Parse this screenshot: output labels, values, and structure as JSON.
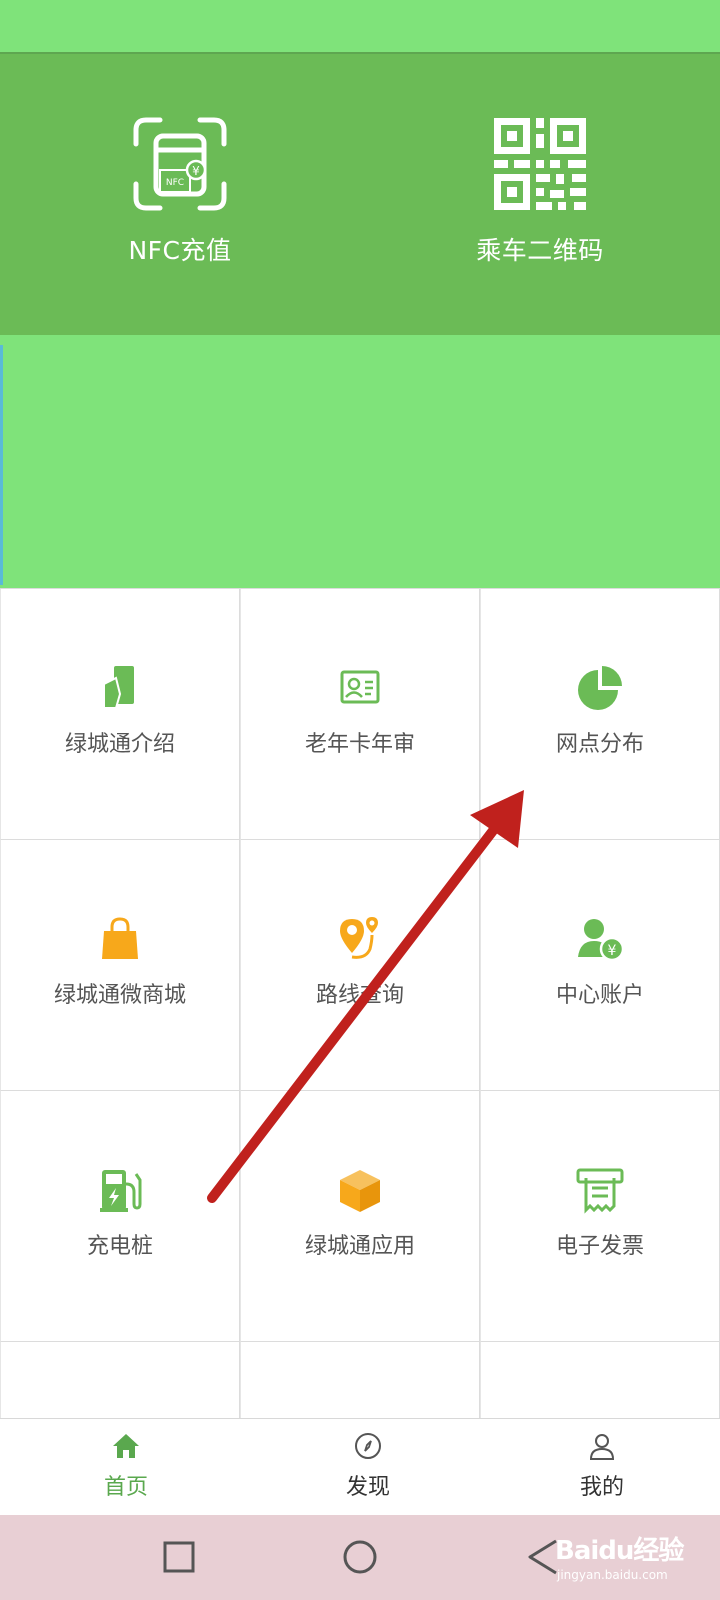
{
  "hero": {
    "nfc_label": "NFC充值",
    "nfc_icon_text": "NFC",
    "qr_label": "乘车二维码"
  },
  "grid": {
    "items": [
      {
        "label": "绿城通介绍",
        "icon": "card-hand-icon"
      },
      {
        "label": "老年卡年审",
        "icon": "id-card-icon"
      },
      {
        "label": "网点分布",
        "icon": "pie-chart-icon"
      },
      {
        "label": "绿城通微商城",
        "icon": "shopping-bag-icon"
      },
      {
        "label": "路线查询",
        "icon": "route-pin-icon"
      },
      {
        "label": "中心账户",
        "icon": "user-yuan-icon"
      },
      {
        "label": "充电桩",
        "icon": "charging-pile-icon"
      },
      {
        "label": "绿城通应用",
        "icon": "box-icon"
      },
      {
        "label": "电子发票",
        "icon": "invoice-icon"
      }
    ]
  },
  "bottom_nav": {
    "home_label": "首页",
    "discover_label": "发现",
    "mine_label": "我的",
    "active": "home"
  },
  "watermark": {
    "brand": "Baidu经验",
    "url": "jingyan.baidu.com"
  },
  "colors": {
    "hero_green": "#6bbb56",
    "banner_green": "#7fe37a",
    "icon_green": "#6bbb56",
    "icon_orange": "#f7a81b",
    "arrow_red": "#c0211d"
  }
}
